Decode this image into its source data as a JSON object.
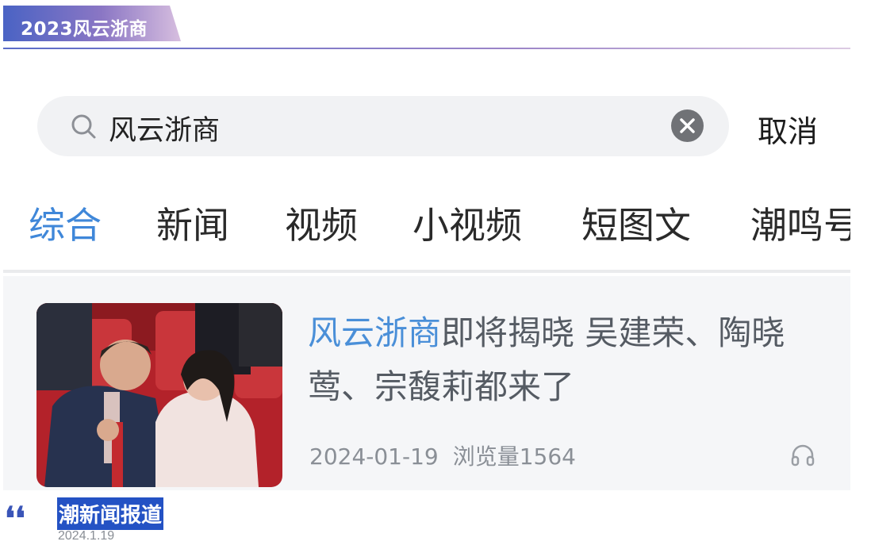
{
  "banner": {
    "title": "2023风云浙商"
  },
  "search": {
    "query": "风云浙商",
    "cancel_label": "取消"
  },
  "tabs": [
    {
      "label": "综合",
      "active": true
    },
    {
      "label": "新闻",
      "active": false
    },
    {
      "label": "视频",
      "active": false
    },
    {
      "label": "小视频",
      "active": false
    },
    {
      "label": "短图文",
      "active": false
    },
    {
      "label": "潮鸣号",
      "active": false
    }
  ],
  "result": {
    "title_highlight": "风云浙商",
    "title_rest": "即将揭晓 吴建荣、陶晓莺、宗馥莉都来了",
    "date": "2024-01-19",
    "views": "浏览量1564"
  },
  "footer": {
    "source": "潮新闻报道",
    "date": "2024.1.19"
  },
  "colors": {
    "accent": "#3f87d9",
    "banner_start": "#4a63c4",
    "banner_end": "#d7bedf",
    "label_bg": "#2452c4"
  }
}
